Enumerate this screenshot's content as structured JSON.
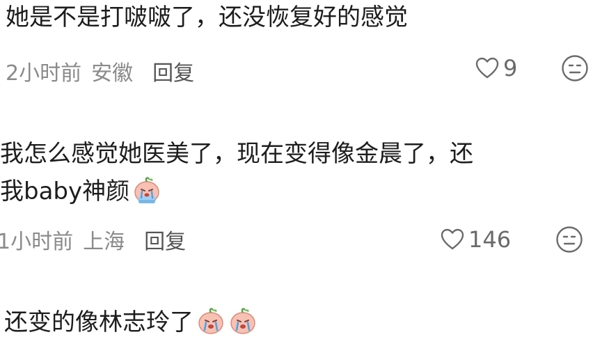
{
  "comments": [
    {
      "text": "她是不是打啵啵了，还没恢复好的感觉",
      "time": "2小时前",
      "location": "安徽",
      "reply_label": "回复",
      "likes": "9"
    },
    {
      "text_line1": "我怎么感觉她医美了，现在变得像金晨了，还",
      "text_line2": "我baby神颜",
      "time": "1小时前",
      "location": "上海",
      "reply_label": "回复",
      "likes": "146"
    },
    {
      "text": "还变的像林志玲了"
    }
  ],
  "icons": {
    "like": "heart-outline-icon",
    "dislike": "meh-face-icon",
    "emoji": "crying-peach-emoji"
  },
  "colors": {
    "text": "#1d1d1d",
    "meta": "#8a8a8a",
    "reply": "#555555",
    "icon": "#6a6a6a"
  }
}
